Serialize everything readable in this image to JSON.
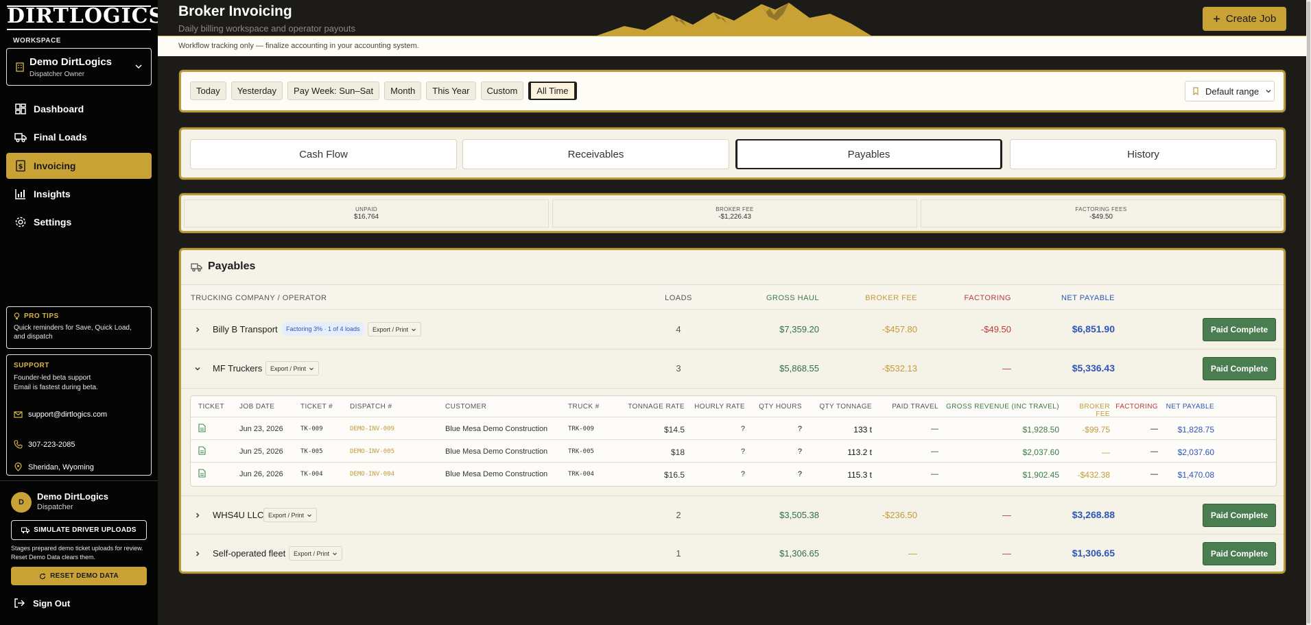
{
  "brand": {
    "logo_text": "DIRTLOGICS"
  },
  "sidebar": {
    "workspace_label": "WORKSPACE",
    "workspace_name": "Demo DirtLogics",
    "workspace_role": "Dispatcher Owner",
    "nav": [
      {
        "label": "Dashboard",
        "icon": "dashboard-icon"
      },
      {
        "label": "Final Loads",
        "icon": "truck-icon"
      },
      {
        "label": "Invoicing",
        "icon": "invoice-icon",
        "active": true
      },
      {
        "label": "Insights",
        "icon": "chart-icon"
      },
      {
        "label": "Settings",
        "icon": "gear-icon"
      }
    ],
    "tips_title": "PRO TIPS",
    "tips_text": "Quick reminders for Save, Quick Load, and dispatch",
    "support_title": "SUPPORT",
    "support_line1": "Founder-led beta support",
    "support_line2": "Email is fastest during beta.",
    "support_email": "support@dirtlogics.com",
    "support_phone": "307-223-2085",
    "support_location": "Sheridan, Wyoming",
    "user_initial": "D",
    "user_name": "Demo DirtLogics",
    "user_role": "Dispatcher",
    "simulate_label": "SIMULATE DRIVER UPLOADS",
    "simulate_note": "Stages prepared demo ticket uploads for review. Reset Demo Data clears them.",
    "reset_label": "RESET DEMO DATA",
    "signout_label": "Sign Out"
  },
  "header": {
    "title": "Broker Invoicing",
    "subtitle": "Daily billing workspace and operator payouts",
    "create_label": "Create Job",
    "notice": "Workflow tracking only — finalize accounting in your accounting system."
  },
  "range": {
    "buttons": [
      "Today",
      "Yesterday",
      "Pay Week: Sun–Sat",
      "Month",
      "This Year",
      "Custom",
      "All Time"
    ],
    "active": "All Time",
    "default_label": "Default range"
  },
  "tabs": [
    "Cash Flow",
    "Receivables",
    "Payables",
    "History"
  ],
  "active_tab": "Payables",
  "summary": [
    {
      "label": "UNPAID",
      "value": "$16,764"
    },
    {
      "label": "BROKER FEE",
      "value": "-$1,226.43"
    },
    {
      "label": "FACTORING FEES",
      "value": "-$49.50"
    }
  ],
  "payables": {
    "title": "Payables",
    "columns": {
      "operator": "TRUCKING COMPANY / OPERATOR",
      "loads": "LOADS",
      "gross": "GROSS HAUL",
      "broker": "BROKER FEE",
      "factoring": "FACTORING",
      "net": "NET PAYABLE"
    },
    "export_label": "Export / Print",
    "paid_label": "Paid Complete",
    "rows": [
      {
        "name": "Billy B Transport",
        "badge": "Factoring 3% · 1 of 4 loads",
        "loads": "4",
        "gross": "$7,359.20",
        "broker": "-$457.80",
        "factoring": "-$49.50",
        "net": "$6,851.90"
      },
      {
        "name": "MF Truckers",
        "loads": "3",
        "gross": "$5,868.55",
        "broker": "-$532.13",
        "factoring": "—",
        "net": "$5,336.43"
      },
      {
        "name": "WHS4U LLC",
        "loads": "2",
        "gross": "$3,505.38",
        "broker": "-$236.50",
        "factoring": "—",
        "net": "$3,268.88"
      },
      {
        "name": "Self-operated fleet",
        "loads": "1",
        "gross": "$1,306.65",
        "broker": "—",
        "factoring": "—",
        "net": "$1,306.65"
      }
    ],
    "detail": {
      "columns": [
        "TICKET",
        "JOB DATE",
        "TICKET #",
        "DISPATCH #",
        "CUSTOMER",
        "TRUCK #",
        "TONNAGE RATE",
        "HOURLY RATE",
        "QTY HOURS",
        "QTY TONNAGE",
        "PAID TRAVEL",
        "GROSS REVENUE (INC TRAVEL)",
        "BROKER FEE",
        "FACTORING",
        "NET PAYABLE"
      ],
      "rows": [
        {
          "date": "Jun 23, 2026",
          "ticket": "TK-009",
          "dispatch": "DEMO-INV-009",
          "customer": "Blue Mesa Demo Construction",
          "truck": "TRK-009",
          "ton_rate": "$14.5",
          "hourly": "?",
          "qty_hours": "?",
          "qty_ton": "133 t",
          "travel": "—",
          "gross": "$1,928.50",
          "broker": "-$99.75",
          "factoring": "—",
          "net": "$1,828.75"
        },
        {
          "date": "Jun 25, 2026",
          "ticket": "TK-005",
          "dispatch": "DEMO-INV-005",
          "customer": "Blue Mesa Demo Construction",
          "truck": "TRK-005",
          "ton_rate": "$18",
          "hourly": "?",
          "qty_hours": "?",
          "qty_ton": "113.2 t",
          "travel": "—",
          "gross": "$2,037.60",
          "broker": "—",
          "factoring": "—",
          "net": "$2,037.60"
        },
        {
          "date": "Jun 26, 2026",
          "ticket": "TK-004",
          "dispatch": "DEMO-INV-004",
          "customer": "Blue Mesa Demo Construction",
          "truck": "TRK-004",
          "ton_rate": "$16.5",
          "hourly": "?",
          "qty_hours": "?",
          "qty_ton": "115.3 t",
          "travel": "—",
          "gross": "$1,902.45",
          "broker": "-$432.38",
          "factoring": "—",
          "net": "$1,470.08"
        }
      ]
    }
  },
  "colors": {
    "gold": "#c9a235",
    "green": "#4a7d4f",
    "blue": "#2e55b8",
    "red": "#b83a3a"
  }
}
